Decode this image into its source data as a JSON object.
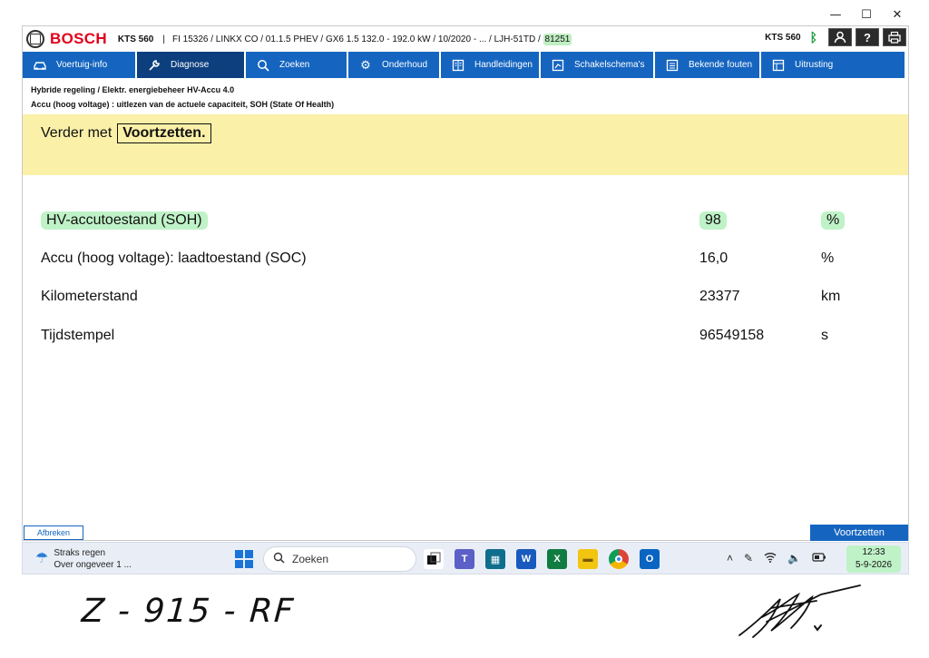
{
  "window": {
    "minimize": "—",
    "maximize": "☐",
    "close": "✕"
  },
  "titlebar": {
    "brand": "BOSCH",
    "device": "KTS 560",
    "separator": "|",
    "info": "FI 15326 / LINKX   CO / 01.1.5 PHEV / GX6 1.5 132.0 - 192.0 kW / 10/2020 - ... / LJH-51TD /",
    "code": "81251",
    "device_right": "KTS 560"
  },
  "menu": [
    {
      "label": "Voertuig-info",
      "icon": "car-icon"
    },
    {
      "label": "Diagnose",
      "icon": "wrench-icon"
    },
    {
      "label": "Zoeken",
      "icon": "search-icon"
    },
    {
      "label": "Onderhoud",
      "icon": "gear-icon"
    },
    {
      "label": "Handleidingen",
      "icon": "book-icon"
    },
    {
      "label": "Schakelschema's",
      "icon": "schematic-icon"
    },
    {
      "label": "Bekende fouten",
      "icon": "list-icon"
    },
    {
      "label": "Uitrusting",
      "icon": "equipment-icon"
    }
  ],
  "breadcrumb": {
    "line1": "Hybride regeling / Elektr. energiebeheer HV-Accu 4.0",
    "line2": "Accu (hoog voltage) : uitlezen van de actuele capaciteit, SOH (State Of Health)"
  },
  "banner": {
    "text": "Verder met",
    "button": "Voortzetten."
  },
  "measurements": [
    {
      "label": "HV-accutoestand (SOH)",
      "value": "98",
      "unit": "%"
    },
    {
      "label": "Accu (hoog voltage): laadtoestand (SOC)",
      "value": "16,0",
      "unit": "%"
    },
    {
      "label": "Kilometerstand",
      "value": "23377",
      "unit": "km"
    },
    {
      "label": "Tijdstempel",
      "value": "96549158",
      "unit": "s"
    }
  ],
  "footer": {
    "abort": "Afbreken",
    "continue": "Voortzetten"
  },
  "taskbar": {
    "weather_title": "Straks regen",
    "weather_sub": "Over ongeveer 1 ...",
    "search_placeholder": "Zoeken",
    "time": "12:33",
    "date": "5-9-2026"
  },
  "handwriting": {
    "plate": "Z - 915 - RF"
  }
}
